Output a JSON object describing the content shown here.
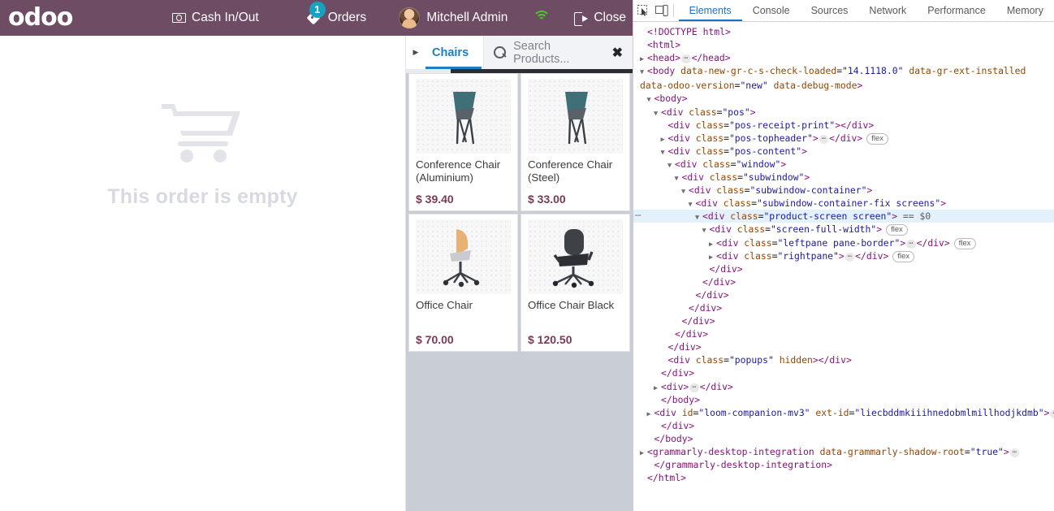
{
  "pos": {
    "brand": "odoo",
    "header": {
      "cash_in_out_label": "Cash In/Out",
      "orders_label": "Orders",
      "orders_badge": "1",
      "user_name": "Mitchell Admin",
      "close_label": "Close"
    },
    "order_panel": {
      "empty_text": "This order is empty"
    },
    "catalog": {
      "active_category": "Chairs",
      "search_placeholder": "Search Products...",
      "clear_icon": "✖",
      "products": [
        {
          "name": "Conference Chair (Aluminium)",
          "price": "$ 39.40",
          "image": "conference-chair-teal"
        },
        {
          "name": "Conference Chair (Steel)",
          "price": "$ 33.00",
          "image": "conference-chair-teal"
        },
        {
          "name": "Office Chair",
          "price": "$ 70.00",
          "image": "office-chair-tan"
        },
        {
          "name": "Office Chair Black",
          "price": "$ 120.50",
          "image": "office-chair-black"
        }
      ]
    }
  },
  "devtools": {
    "tabs": [
      {
        "label": "Elements",
        "active": true
      },
      {
        "label": "Console",
        "active": false
      },
      {
        "label": "Sources",
        "active": false
      },
      {
        "label": "Network",
        "active": false
      },
      {
        "label": "Performance",
        "active": false
      },
      {
        "label": "Memory",
        "active": false
      }
    ],
    "dom_lines": [
      {
        "indent": 0,
        "html": "<span class=\"tag\">&lt;!DOCTYPE html&gt;</span>",
        "tri": "none"
      },
      {
        "indent": 0,
        "html": "<span class=\"tag\">&lt;html&gt;</span>",
        "tri": "none"
      },
      {
        "indent": 0,
        "html": "<span class=\"tag\">&lt;head&gt;</span><span class=\"txtdots\">⋯</span><span class=\"tag\">&lt;/head&gt;</span>",
        "tri": "closed"
      },
      {
        "indent": 0,
        "wrap": true,
        "html": "<span class=\"tag\">&lt;body</span> <span class=\"attr\">data-new-gr-c-s-check-loaded</span>=<span class=\"val\">\"14.1118.0\"</span> <span class=\"attr\">data-gr-ext-installed</span> <span class=\"attr\">data-odoo-version</span>=<span class=\"val\">\"new\"</span> <span class=\"attr\">data-debug-mode</span><span class=\"tag\">&gt;</span>",
        "tri": "open"
      },
      {
        "indent": 1,
        "html": "<span class=\"tag\">&lt;body&gt;</span>",
        "tri": "open"
      },
      {
        "indent": 2,
        "html": "<span class=\"tag\">&lt;div</span> <span class=\"attr\">class</span>=<span class=\"val\">\"pos\"</span><span class=\"tag\">&gt;</span>",
        "tri": "open"
      },
      {
        "indent": 3,
        "html": "<span class=\"tag\">&lt;div</span> <span class=\"attr\">class</span>=<span class=\"val\">\"pos-receipt-print\"</span><span class=\"tag\">&gt;&lt;/div&gt;</span>",
        "tri": "none"
      },
      {
        "indent": 3,
        "html": "<span class=\"tag\">&lt;div</span> <span class=\"attr\">class</span>=<span class=\"val\">\"pos-topheader\"</span><span class=\"tag\">&gt;</span><span class=\"txtdots\">⋯</span><span class=\"tag\">&lt;/div&gt;</span><span class=\"flexbadge\">flex</span>",
        "tri": "closed"
      },
      {
        "indent": 3,
        "html": "<span class=\"tag\">&lt;div</span> <span class=\"attr\">class</span>=<span class=\"val\">\"pos-content\"</span><span class=\"tag\">&gt;</span>",
        "tri": "open"
      },
      {
        "indent": 4,
        "html": "<span class=\"tag\">&lt;div</span> <span class=\"attr\">class</span>=<span class=\"val\">\"window\"</span><span class=\"tag\">&gt;</span>",
        "tri": "open"
      },
      {
        "indent": 5,
        "html": "<span class=\"tag\">&lt;div</span> <span class=\"attr\">class</span>=<span class=\"val\">\"subwindow\"</span><span class=\"tag\">&gt;</span>",
        "tri": "open"
      },
      {
        "indent": 6,
        "html": "<span class=\"tag\">&lt;div</span> <span class=\"attr\">class</span>=<span class=\"val\">\"subwindow-container\"</span><span class=\"tag\">&gt;</span>",
        "tri": "open"
      },
      {
        "indent": 7,
        "html": "<span class=\"tag\">&lt;div</span> <span class=\"attr\">class</span>=<span class=\"val\">\"subwindow-container-fix screens\"</span><span class=\"tag\">&gt;</span>",
        "tri": "open"
      },
      {
        "indent": 8,
        "selected": true,
        "html": "<span class=\"tag\">&lt;div</span> <span class=\"attr\">class</span>=<span class=\"val\">\"product-screen screen\"</span><span class=\"tag\">&gt;</span> <span class=\"eqs\">== $0</span>",
        "tri": "open"
      },
      {
        "indent": 9,
        "html": "<span class=\"tag\">&lt;div</span> <span class=\"attr\">class</span>=<span class=\"val\">\"screen-full-width\"</span><span class=\"tag\">&gt;</span><span class=\"flexbadge\">flex</span>",
        "tri": "open"
      },
      {
        "indent": 10,
        "html": "<span class=\"tag\">&lt;div</span> <span class=\"attr\">class</span>=<span class=\"val\">\"leftpane pane-border\"</span><span class=\"tag\">&gt;</span><span class=\"txtdots\">⋯</span><span class=\"tag\">&lt;/div&gt;</span><span class=\"flexbadge\">flex</span>",
        "tri": "closed"
      },
      {
        "indent": 10,
        "html": "<span class=\"tag\">&lt;div</span> <span class=\"attr\">class</span>=<span class=\"val\">\"rightpane\"</span><span class=\"tag\">&gt;</span><span class=\"txtdots\">⋯</span><span class=\"tag\">&lt;/div&gt;</span><span class=\"flexbadge\">flex</span>",
        "tri": "closed"
      },
      {
        "indent": 9,
        "html": "<span class=\"tag\">&lt;/div&gt;</span>",
        "tri": "none"
      },
      {
        "indent": 8,
        "html": "<span class=\"tag\">&lt;/div&gt;</span>",
        "tri": "none"
      },
      {
        "indent": 7,
        "html": "<span class=\"tag\">&lt;/div&gt;</span>",
        "tri": "none"
      },
      {
        "indent": 6,
        "html": "<span class=\"tag\">&lt;/div&gt;</span>",
        "tri": "none"
      },
      {
        "indent": 5,
        "html": "<span class=\"tag\">&lt;/div&gt;</span>",
        "tri": "none"
      },
      {
        "indent": 4,
        "html": "<span class=\"tag\">&lt;/div&gt;</span>",
        "tri": "none"
      },
      {
        "indent": 3,
        "html": "<span class=\"tag\">&lt;/div&gt;</span>",
        "tri": "none"
      },
      {
        "indent": 3,
        "html": "<span class=\"tag\">&lt;div</span> <span class=\"attr\">class</span>=<span class=\"val\">\"popups\"</span> <span class=\"attr\">hidden</span><span class=\"tag\">&gt;&lt;/div&gt;</span>",
        "tri": "none"
      },
      {
        "indent": 2,
        "html": "<span class=\"tag\">&lt;/div&gt;</span>",
        "tri": "none"
      },
      {
        "indent": 2,
        "html": "<span class=\"tag\">&lt;div&gt;</span><span class=\"txtdots\">⋯</span><span class=\"tag\">&lt;/div&gt;</span>",
        "tri": "closed"
      },
      {
        "indent": 2,
        "html": "<span class=\"tag\">&lt;/body&gt;</span>",
        "tri": "none"
      },
      {
        "indent": 1,
        "html": "<span class=\"tag\">&lt;div</span> <span class=\"attr\">id</span>=<span class=\"val\">\"loom-companion-mv3\"</span> <span class=\"attr\">ext-id</span>=<span class=\"val\">\"liecbddmkiiihnedobmlmillhodjkdmb\"</span><span class=\"tag\">&gt;</span><span class=\"txtdots\">⋯</span>",
        "tri": "closed"
      },
      {
        "indent": 2,
        "html": "<span class=\"tag\">&lt;/div&gt;</span>",
        "tri": "none"
      },
      {
        "indent": 1,
        "html": "<span class=\"tag\">&lt;/body&gt;</span>",
        "tri": "none"
      },
      {
        "indent": 0,
        "html": "<span class=\"tag\">&lt;grammarly-desktop-integration</span> <span class=\"attr\">data-grammarly-shadow-root</span>=<span class=\"val\">\"true\"</span><span class=\"tag\">&gt;</span><span class=\"txtdots\">⋯</span>",
        "tri": "closed"
      },
      {
        "indent": 1,
        "html": "<span class=\"tag\">&lt;/grammarly-desktop-integration&gt;</span>",
        "tri": "none"
      },
      {
        "indent": 0,
        "html": "<span class=\"tag\">&lt;/html&gt;</span>",
        "tri": "none"
      }
    ]
  },
  "colors": {
    "pos_header_purple": "#6d4c64",
    "badge_blue": "#17a2c4",
    "price_maroon": "#7a3a55",
    "category_active_blue": "#1f7ec0",
    "devtools_active_blue": "#1a73c7",
    "catalog_bg": "#c9cdd6",
    "empty_text_gray": "#d8dae2"
  }
}
